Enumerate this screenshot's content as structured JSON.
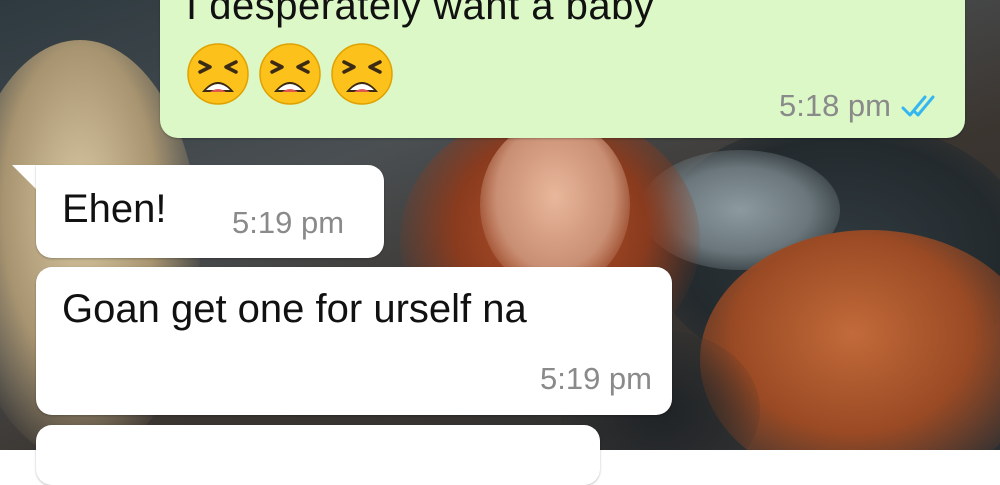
{
  "chat": {
    "outgoing": {
      "text": "I desperately want a baby",
      "emojis": [
        "tired-face",
        "tired-face",
        "tired-face"
      ],
      "time": "5:18 pm",
      "status_icon": "double-check-read-icon",
      "bubble_color": "#dcf8c6",
      "tick_color": "#34b7f1"
    },
    "incoming": [
      {
        "text": "Ehen!",
        "time": "5:19 pm"
      },
      {
        "text": "Goan get one for urself na",
        "time": "5:19 pm"
      }
    ]
  }
}
